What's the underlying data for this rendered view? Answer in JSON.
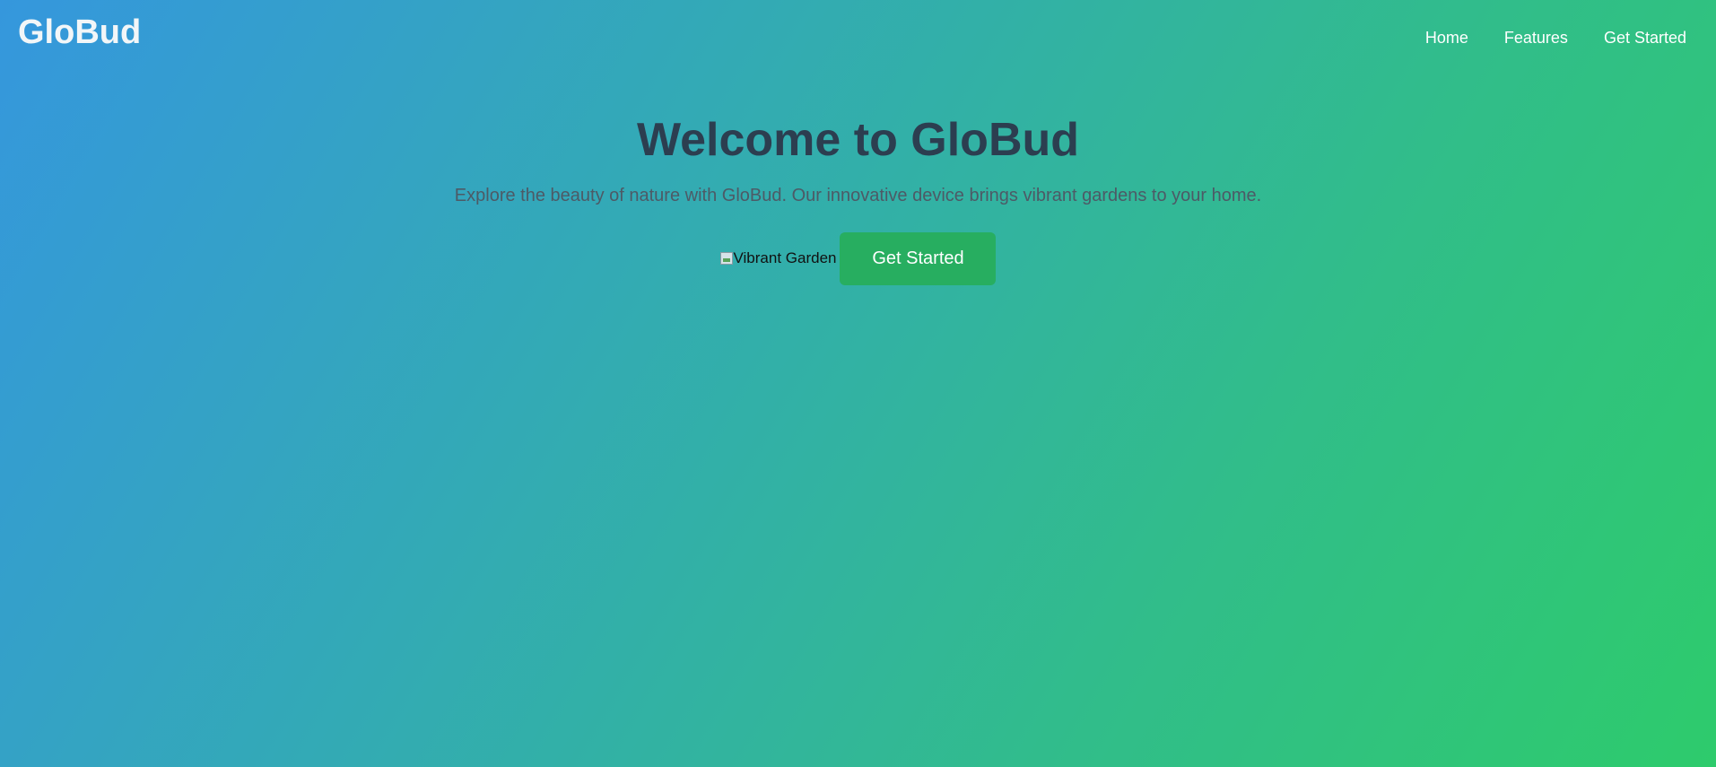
{
  "header": {
    "logo": "GloBud",
    "nav": [
      {
        "label": "Home"
      },
      {
        "label": "Features"
      },
      {
        "label": "Get Started"
      }
    ]
  },
  "hero": {
    "title": "Welcome to GloBud",
    "subtitle": "Explore the beauty of nature with GloBud. Our innovative device brings vibrant gardens to your home.",
    "image_alt": "Vibrant Garden",
    "cta_label": "Get Started"
  },
  "colors": {
    "gradient_start": "#3597dd",
    "gradient_end": "#2ecb6c",
    "title": "#2c3e50",
    "cta_background": "#27ae60"
  },
  "icons": {
    "broken_image": "broken-image-icon"
  }
}
